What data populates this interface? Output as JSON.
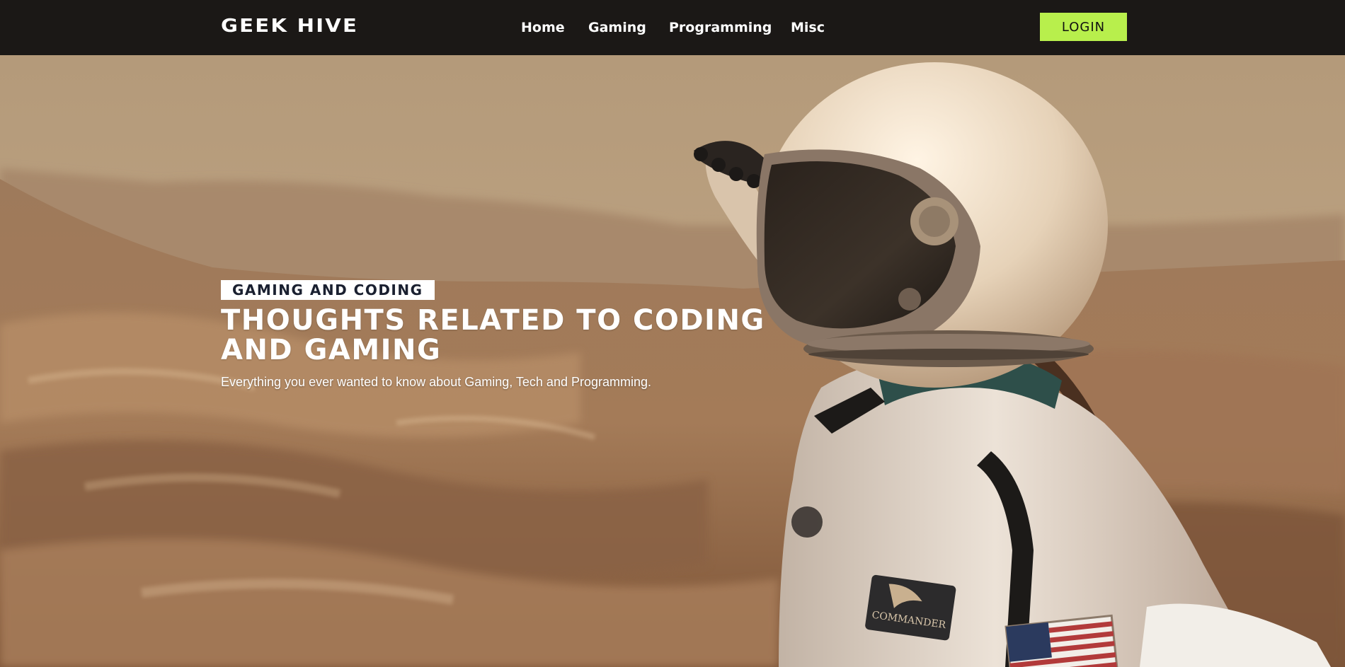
{
  "header": {
    "logo": "GEEK HIVE",
    "nav": [
      {
        "label": "Home"
      },
      {
        "label": "Gaming"
      },
      {
        "label": "Programming"
      },
      {
        "label": "Misc"
      }
    ],
    "login_label": "LOGIN"
  },
  "hero": {
    "tag": "GAMING AND CODING",
    "title": "THOUGHTS RELATED TO CODING AND GAMING",
    "subtitle": "Everything you ever wanted to know about Gaming, Tech and Programming.",
    "image_badge_text": "COMMANDER"
  },
  "colors": {
    "header_bg": "#1b1816",
    "accent": "#b8ef4c",
    "tag_bg": "#ffffff",
    "tag_text": "#1a2030"
  }
}
